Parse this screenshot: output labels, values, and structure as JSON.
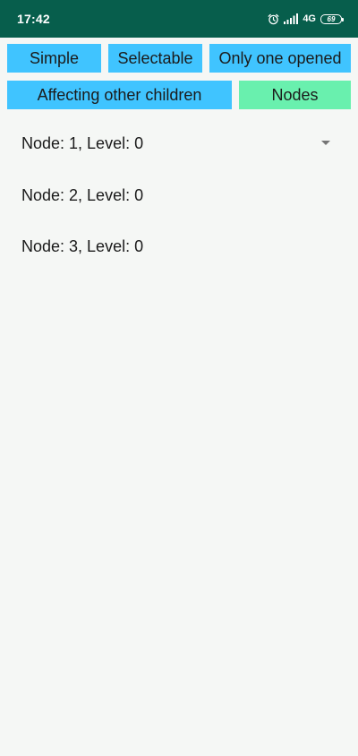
{
  "status_bar": {
    "time": "17:42",
    "network": "4G",
    "battery": "69"
  },
  "toolbar": {
    "row1": [
      "Simple",
      "Selectable",
      "Only one opened"
    ],
    "row2": [
      "Affecting other children",
      "Nodes"
    ],
    "active": "Nodes",
    "colors": {
      "default": "#40c4ff",
      "active": "#69f0ae"
    }
  },
  "nodes": [
    {
      "label": "Node: 1, Level: 0",
      "expandable": true
    },
    {
      "label": "Node: 2, Level: 0",
      "expandable": false
    },
    {
      "label": "Node: 3, Level: 0",
      "expandable": false
    }
  ]
}
